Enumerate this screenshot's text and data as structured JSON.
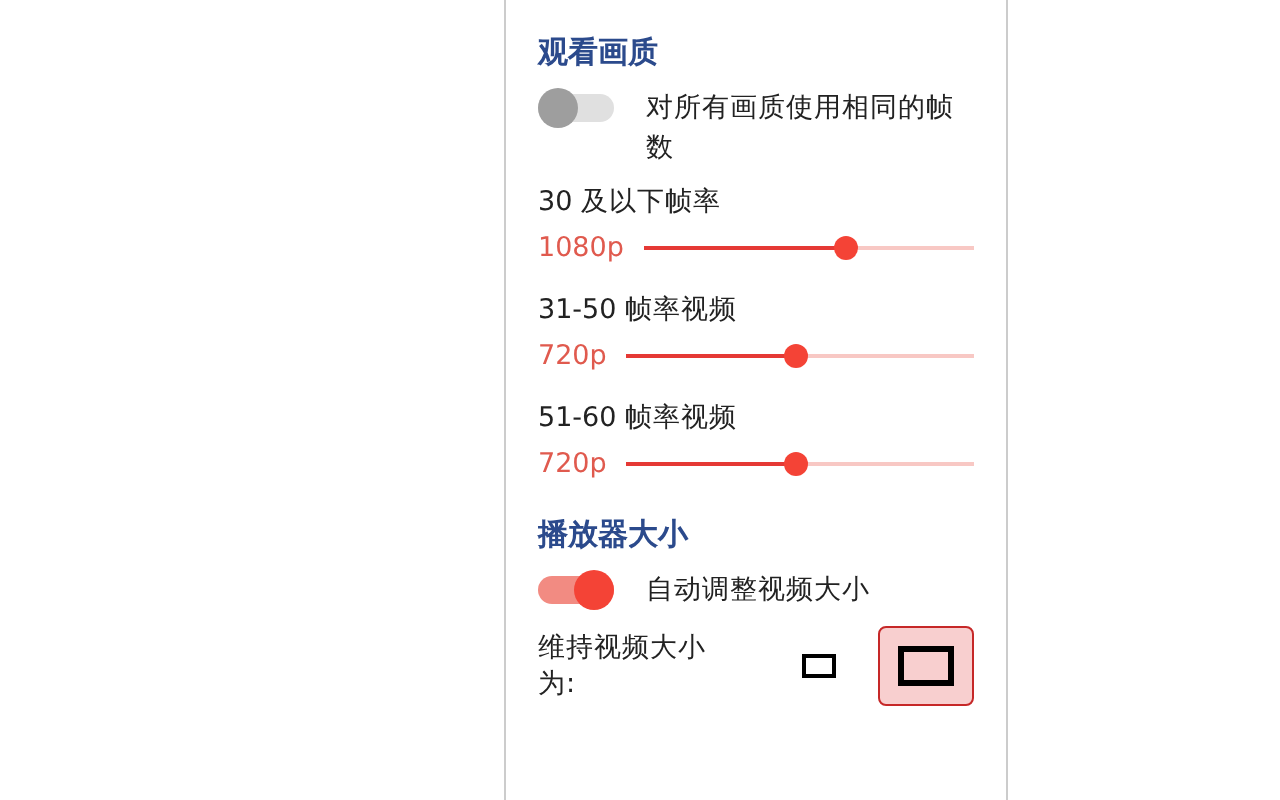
{
  "sections": [
    {
      "title": "观看画质",
      "toggle": {
        "label": "对所有画质使用相同的帧数",
        "on": false
      },
      "sliders": [
        {
          "label": "30 及以下帧率",
          "reading": "1080p",
          "level": 0.61
        },
        {
          "label": "31-50 帧率视频",
          "reading": "720p",
          "level": 0.49
        },
        {
          "label": "51-60 帧率视频",
          "reading": "720p",
          "level": 0.49
        }
      ]
    },
    {
      "title": "播放器大小",
      "toggle": {
        "label": "自动调整视频大小",
        "on": true
      },
      "size_choice": {
        "label": "维持视频大小为:",
        "options": [
          {
            "kind": "small",
            "selected": false
          },
          {
            "kind": "large",
            "selected": true
          }
        ]
      }
    }
  ]
}
